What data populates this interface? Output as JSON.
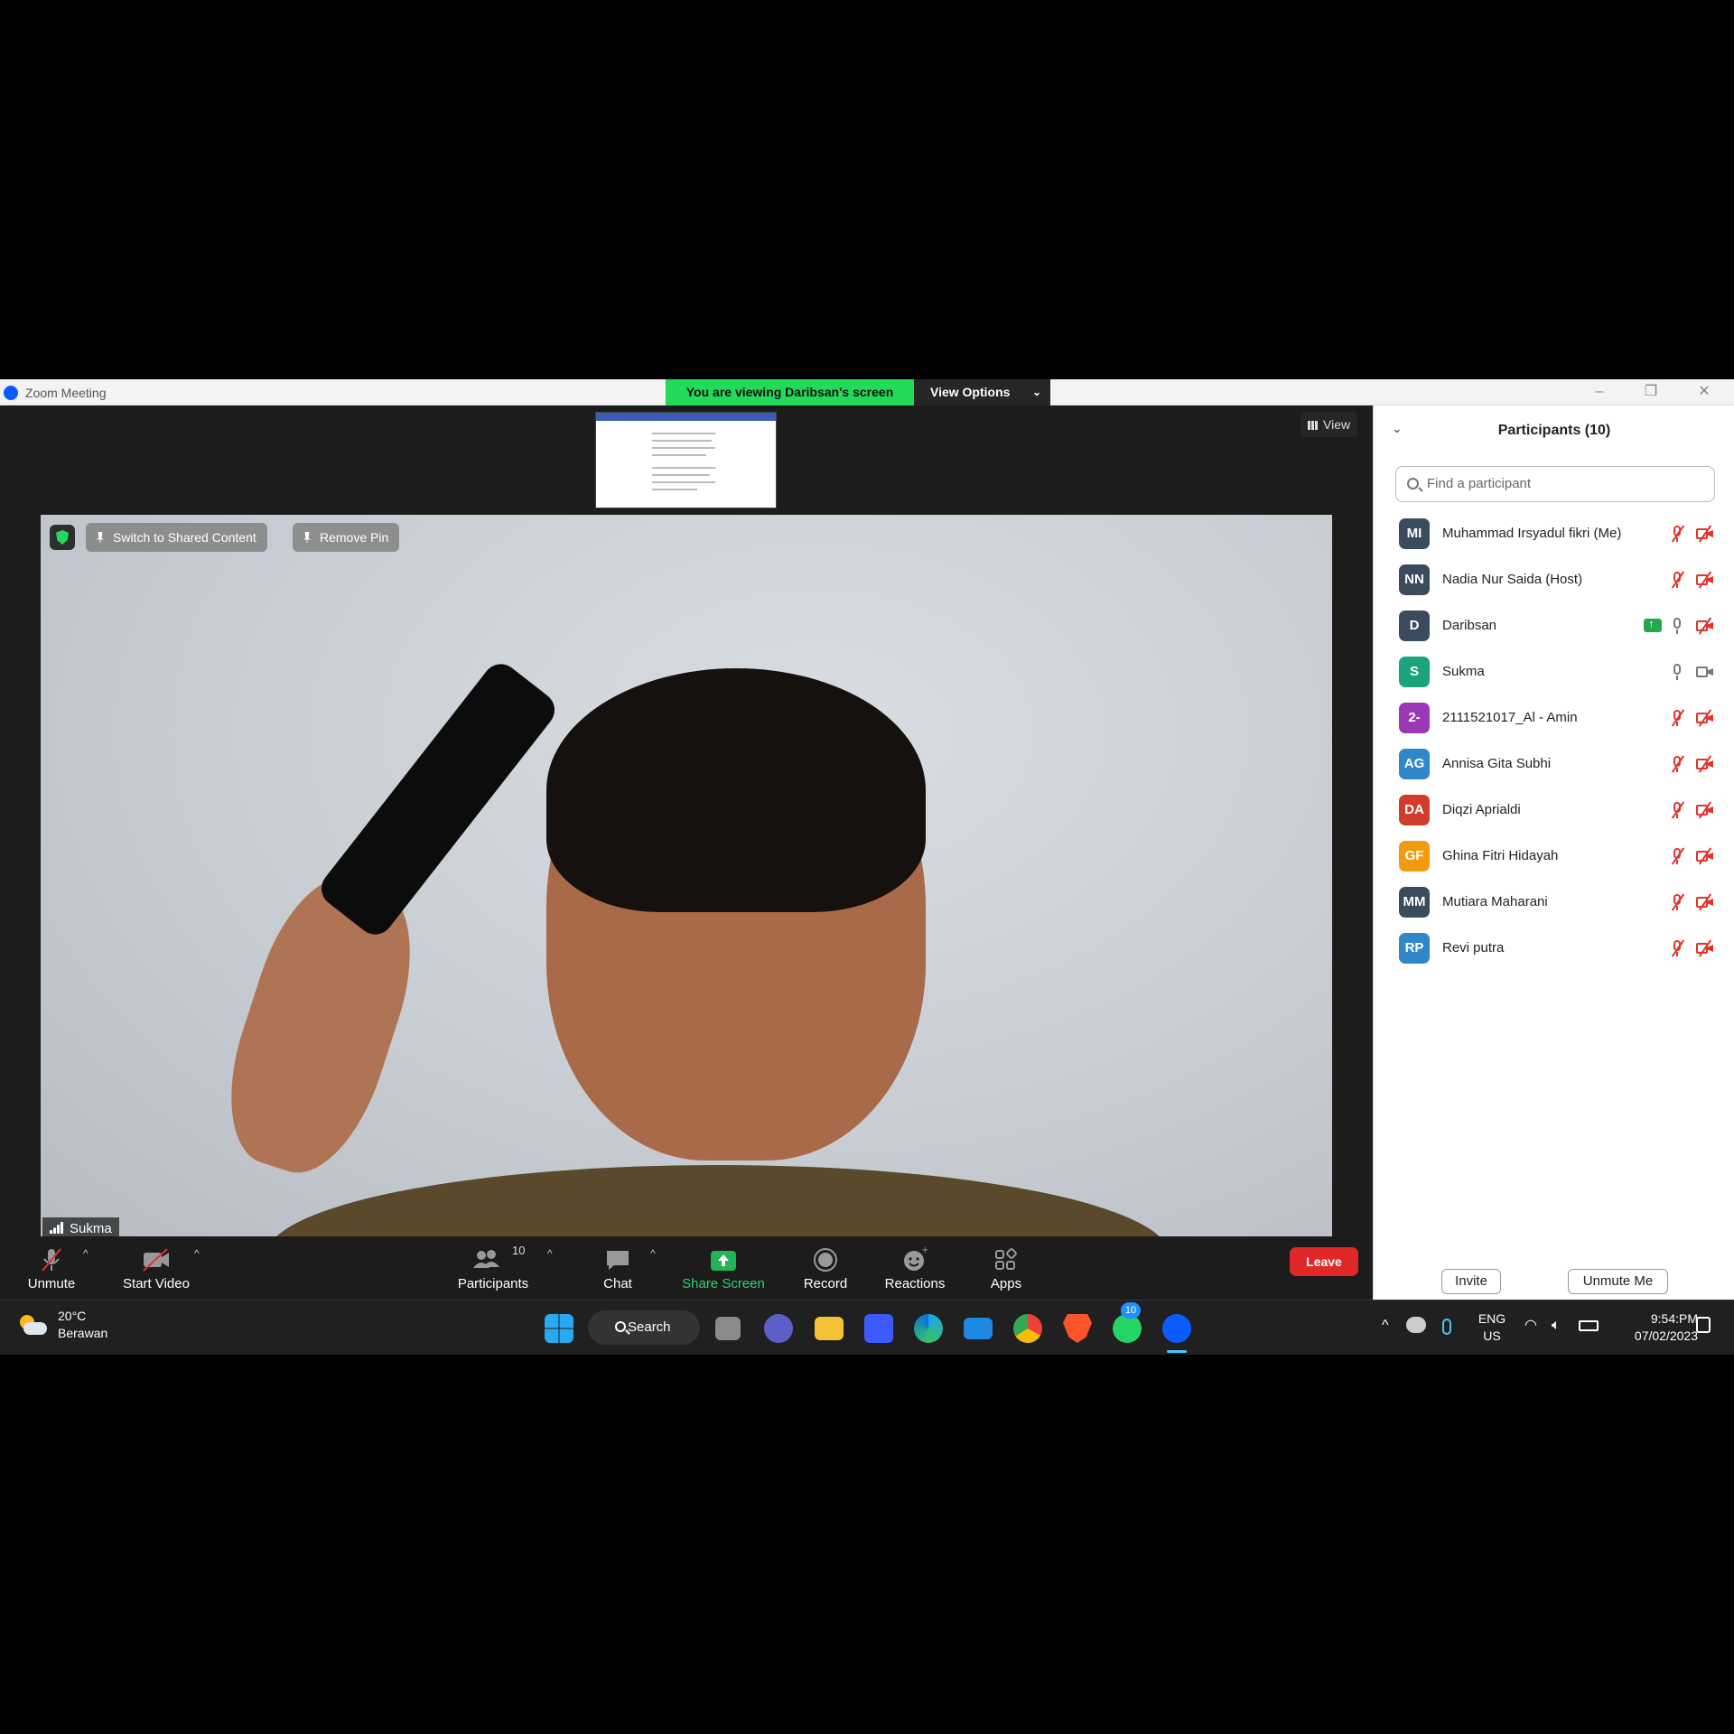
{
  "window": {
    "title": "Zoom Meeting",
    "viewing_banner": "You are viewing Daribsan's screen",
    "view_options": "View Options",
    "view_button": "View"
  },
  "video": {
    "switch_label": "Switch to Shared Content",
    "remove_pin_label": "Remove Pin",
    "speaker_name": "Sukma"
  },
  "toolbar": {
    "unmute": "Unmute",
    "start_video": "Start Video",
    "participants": "Participants",
    "participants_count": "10",
    "chat": "Chat",
    "share_screen": "Share Screen",
    "record": "Record",
    "reactions": "Reactions",
    "apps": "Apps",
    "leave": "Leave"
  },
  "panel": {
    "title": "Participants (10)",
    "search_placeholder": "Find a participant",
    "invite": "Invite",
    "unmute_me": "Unmute Me",
    "participants": [
      {
        "initials": "MI",
        "name": "Muhammad Irsyadul fikri (Me)",
        "color": "#3b4b5e",
        "mic": "off",
        "cam": "off",
        "sharing": false
      },
      {
        "initials": "NN",
        "name": "Nadia Nur Saida (Host)",
        "color": "#3b4b5e",
        "mic": "off",
        "cam": "off",
        "sharing": false
      },
      {
        "initials": "D",
        "name": "Daribsan",
        "color": "#3b4b5e",
        "mic": "on",
        "cam": "off",
        "sharing": true
      },
      {
        "initials": "S",
        "name": "Sukma",
        "color": "#1ba37c",
        "mic": "on",
        "cam": "on",
        "sharing": false
      },
      {
        "initials": "2-",
        "name": "2111521017_Al - Amin",
        "color": "#9b38b8",
        "mic": "off",
        "cam": "off",
        "sharing": false
      },
      {
        "initials": "AG",
        "name": "Annisa Gita Subhi",
        "color": "#2f86c9",
        "mic": "off",
        "cam": "off",
        "sharing": false
      },
      {
        "initials": "DA",
        "name": "Diqzi Aprialdi",
        "color": "#d13c2c",
        "mic": "off",
        "cam": "off",
        "sharing": false
      },
      {
        "initials": "GF",
        "name": "Ghina Fitri Hidayah",
        "color": "#f29b11",
        "mic": "off",
        "cam": "off",
        "sharing": false
      },
      {
        "initials": "MM",
        "name": "Mutiara Maharani",
        "color": "#3b4b5e",
        "mic": "off",
        "cam": "off",
        "sharing": false
      },
      {
        "initials": "RP",
        "name": "Revi putra",
        "color": "#2f86c9",
        "mic": "off",
        "cam": "off",
        "sharing": false
      }
    ]
  },
  "taskbar": {
    "temperature": "20°C",
    "weather": "Berawan",
    "search": "Search",
    "whatsapp_badge": "10",
    "lang_top": "ENG",
    "lang_bottom": "US",
    "time": "9:54:PM",
    "date": "07/02/2023"
  }
}
